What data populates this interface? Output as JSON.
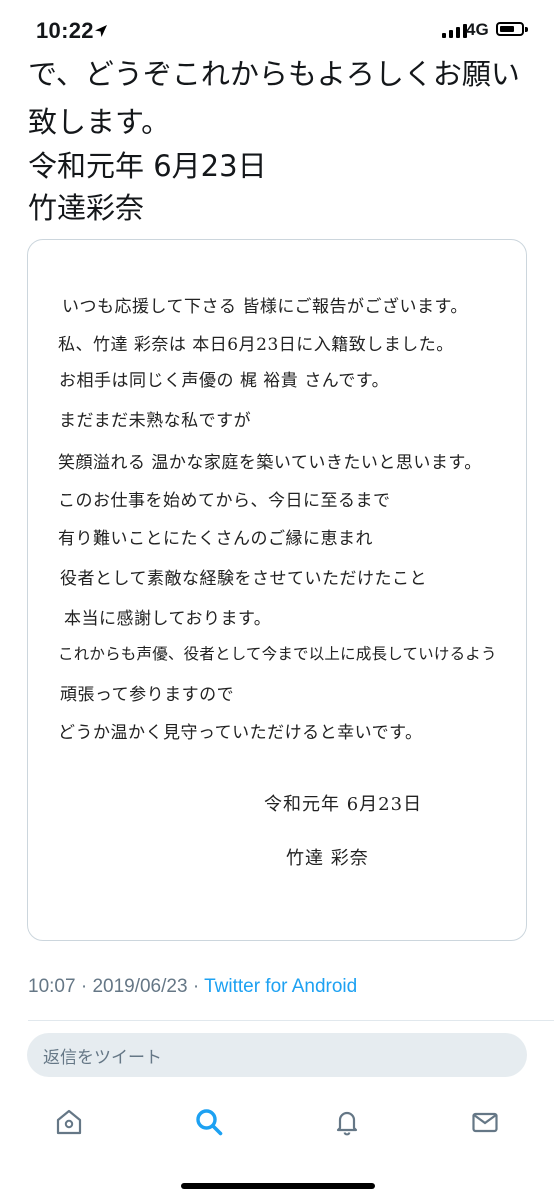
{
  "status_bar": {
    "time": "10:22",
    "network": "4G"
  },
  "tweet": {
    "text_lines": [
      "で、どうぞこれからもよろしくお願い",
      "致します。"
    ],
    "date": "令和元年 6月23日",
    "author_name": "竹達彩奈"
  },
  "letter": {
    "lines": [
      "いつも応援して下さる 皆様にご報告がございます。",
      "私、竹達 彩奈は 本日6月23日に入籍致しました。",
      "お相手は同じく声優の 梶 裕貴 さんです。",
      "まだまだ未熟な私ですが",
      "笑顔溢れる 温かな家庭を築いていきたいと思います。",
      "このお仕事を始めてから、今日に至るまで",
      "有り難いことにたくさんのご縁に恵まれ",
      "役者として素敵な経験をさせていただけたこと",
      "本当に感謝しております。",
      "これからも声優、役者として今まで以上に成長していけるよう",
      "頑張って参りますので",
      "どうか温かく見守っていただけると幸いです。"
    ],
    "signature_date": "令和元年 6月23日",
    "signature_name": "竹達 彩奈"
  },
  "meta": {
    "time": "10:07",
    "separator": "·",
    "date": "2019/06/23",
    "source": "Twitter for Android"
  },
  "reply_box": {
    "placeholder": "返信をツイート"
  },
  "tabs": [
    {
      "name": "home",
      "icon": "home-icon"
    },
    {
      "name": "search",
      "icon": "search-icon"
    },
    {
      "name": "notifications",
      "icon": "bell-icon"
    },
    {
      "name": "messages",
      "icon": "mail-icon"
    }
  ],
  "colors": {
    "accent": "#1da1f2",
    "muted": "#657786",
    "reply_bg": "#e6ecf0",
    "border": "#ccd6dd"
  }
}
